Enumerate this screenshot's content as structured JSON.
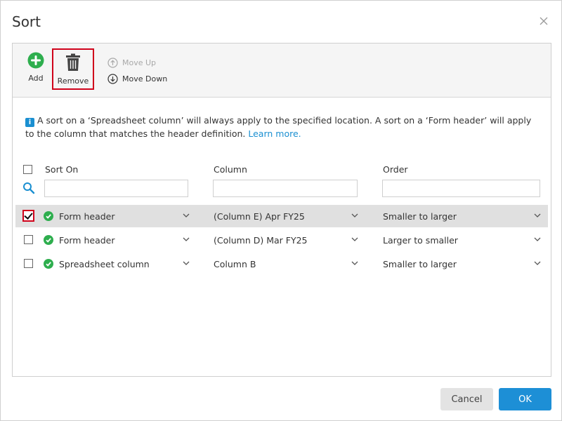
{
  "dialog": {
    "title": "Sort"
  },
  "toolbar": {
    "add_label": "Add",
    "remove_label": "Remove",
    "move_up_label": "Move Up",
    "move_down_label": "Move Down"
  },
  "info": {
    "text": "A sort on a ‘Spreadsheet column’ will always apply to the specified location. A sort on a ‘Form header’ will apply to the column that matches the header definition.",
    "link": "Learn more."
  },
  "table": {
    "headers": {
      "sort_on": "Sort On",
      "column": "Column",
      "order": "Order"
    },
    "filters": {
      "sort_on": "",
      "column": "",
      "order": ""
    },
    "rows": [
      {
        "checked": true,
        "selected": true,
        "sort_on": "Form header",
        "column": "(Column E) Apr FY25",
        "order": "Smaller to larger"
      },
      {
        "checked": false,
        "selected": false,
        "sort_on": "Form header",
        "column": "(Column D) Mar FY25",
        "order": "Larger to smaller"
      },
      {
        "checked": false,
        "selected": false,
        "sort_on": "Spreadsheet column",
        "column": "Column B",
        "order": "Smaller to larger"
      }
    ]
  },
  "footer": {
    "cancel_label": "Cancel",
    "ok_label": "OK"
  },
  "colors": {
    "accent": "#1d8fd6",
    "success": "#2eae4e",
    "highlight": "#d0021b"
  }
}
